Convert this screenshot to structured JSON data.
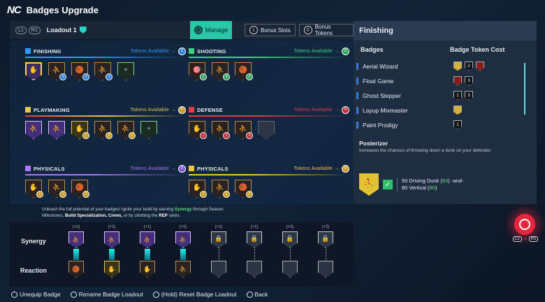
{
  "header": {
    "logo": "NC",
    "title": "Badges Upgrade"
  },
  "topbar": {
    "left_pills": [
      "L1",
      "R1"
    ],
    "loadout_name": "Loadout 1",
    "manage_label": "Manage",
    "bonus_slots_count": "1",
    "bonus_slots_label": "Bonus Slots",
    "bonus_tokens_count": "0",
    "bonus_tokens_label": "Bonus Tokens"
  },
  "categories": [
    {
      "name": "FINISHING",
      "tokens_label": "Tokens Available",
      "tokens": "2",
      "color": "#2f9bff"
    },
    {
      "name": "SHOOTING",
      "tokens_label": "Tokens Available",
      "tokens": "0",
      "color": "#3fd27f"
    },
    {
      "name": "PLAYMAKING",
      "tokens_label": "Tokens Available",
      "tokens": "0",
      "color": "#e6c84a"
    },
    {
      "name": "DEFENSE",
      "tokens_label": "Tokens Available",
      "tokens": "0",
      "color": "#e23b4a"
    },
    {
      "name": "PHYSICALS",
      "tokens_label": "Tokens Available",
      "tokens": "0",
      "color": "#a87aff"
    },
    {
      "name": "PHYSICALS",
      "tokens_label": "Tokens Available",
      "tokens": "0",
      "color": "#f1c33a"
    }
  ],
  "message": {
    "pre": "Unleash the full potential of your badges! Ignite your build by earning",
    "synergy": "Synergy",
    "post1": "through Season",
    "line2a": "Milestones,",
    "line2b": "Build Specialization, Crews,",
    "line2c": "or by climbing the",
    "line2d": "REP",
    "line2e": "ranks."
  },
  "bottom": {
    "synergy_label": "Synergy",
    "reaction_label": "Reaction",
    "slots": [
      "(+1)",
      "(+1)",
      "(+1)",
      "(+1)",
      "(+1)",
      "(+1)",
      "(+2)",
      "(+2)"
    ]
  },
  "right": {
    "title": "Finishing",
    "col_badges": "Badges",
    "col_cost": "Badge Token Cost",
    "items": [
      {
        "name": "Aerial Wizard",
        "tokens": [
          "2"
        ]
      },
      {
        "name": "Float Game",
        "tokens": [
          "3"
        ]
      },
      {
        "name": "Ghost Stepper",
        "tokens": [
          "1",
          "3"
        ]
      },
      {
        "name": "Layup Mixmaster",
        "tokens": []
      },
      {
        "name": "Paint Prodigy",
        "tokens": [
          "1"
        ]
      }
    ],
    "posterizer_title": "Posterizer",
    "posterizer_desc": "Increases the chances of throwing down a dunk on your defender.",
    "req_line1_a": "93 Driving Dunk (",
    "req_line1_val": "93",
    "req_line1_b": ") -and-",
    "req_line2_a": "80 Vertical (",
    "req_line2_val": "80",
    "req_line2_b": ")"
  },
  "fab": {
    "key1": "L1",
    "key2": "R1"
  },
  "footer": {
    "unequip": "Unequip Badge",
    "rename": "Rename Badge Loadout",
    "reset": "(Hold) Reset Badge Loadout",
    "back": "Back"
  }
}
